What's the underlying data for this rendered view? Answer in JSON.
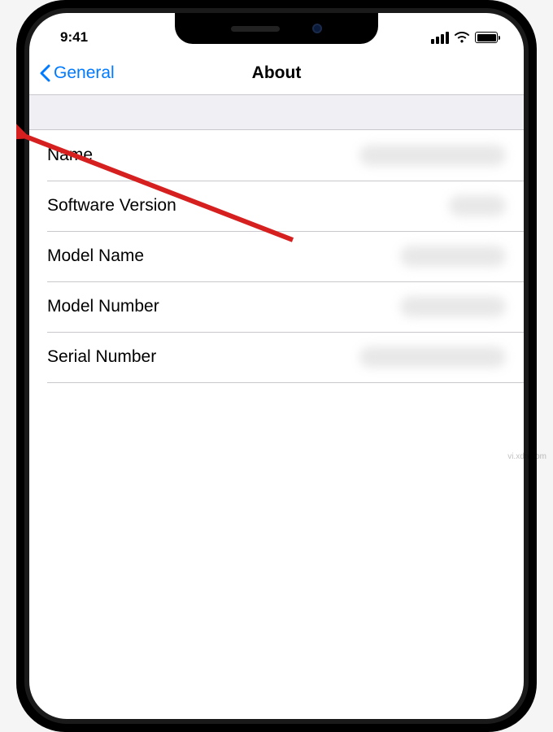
{
  "status": {
    "time": "9:41"
  },
  "nav": {
    "back_label": "General",
    "title": "About"
  },
  "rows": [
    {
      "label": "Name"
    },
    {
      "label": "Software Version"
    },
    {
      "label": "Model Name"
    },
    {
      "label": "Model Number"
    },
    {
      "label": "Serial Number"
    }
  ],
  "watermark": "vi.xdn.com"
}
